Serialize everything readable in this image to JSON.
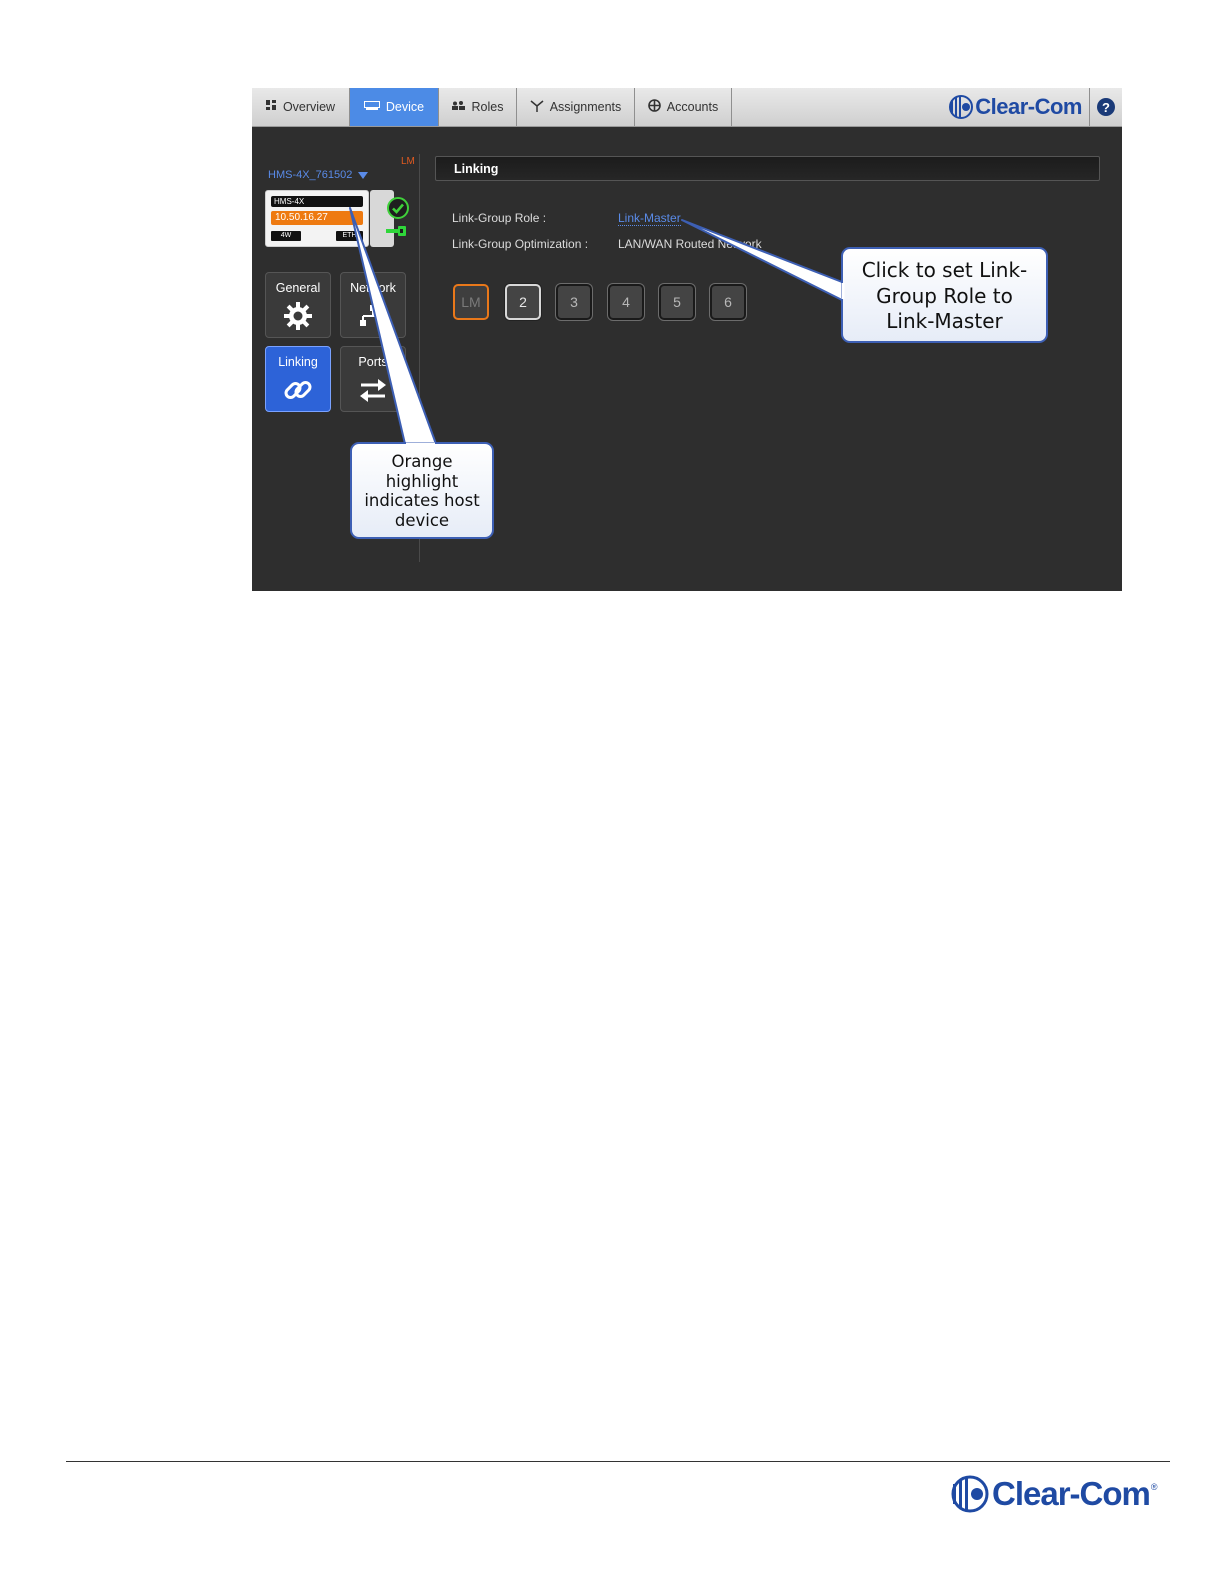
{
  "tabs": [
    {
      "label": "Overview",
      "icon": "grid-icon",
      "active": false
    },
    {
      "label": "Device",
      "icon": "device-icon",
      "active": true
    },
    {
      "label": "Roles",
      "icon": "roles-icon",
      "active": false
    },
    {
      "label": "Assignments",
      "icon": "assignments-icon",
      "active": false
    },
    {
      "label": "Accounts",
      "icon": "accounts-icon",
      "active": false
    }
  ],
  "brand": {
    "name": "Clear-Com",
    "color": "#1f4aa3"
  },
  "help": {
    "label": "?"
  },
  "sidebar": {
    "lm_flag": "LM",
    "device_select": "HMS-4X_761502",
    "device_card": {
      "name": "HMS-4X",
      "ip": "10.50.16.27",
      "port1": "4W",
      "port2": "ETH"
    },
    "nav": [
      {
        "label": "General",
        "icon": "gear-icon",
        "active": false
      },
      {
        "label": "Network",
        "icon": "network-icon",
        "active": false
      },
      {
        "label": "Linking",
        "icon": "link-icon",
        "active": true
      },
      {
        "label": "Ports",
        "icon": "arrows-icon",
        "active": false
      }
    ]
  },
  "linking": {
    "section_title": "Linking",
    "role_label": "Link-Group Role :",
    "role_value": "Link-Master",
    "optimization_label": "Link-Group Optimization :",
    "optimization_value": "LAN/WAN Routed Network",
    "slots": [
      "LM",
      "2",
      "3",
      "4",
      "5",
      "6"
    ]
  },
  "callouts": {
    "role": [
      "Click to set Link-",
      "Group Role to",
      "Link-Master"
    ],
    "host": [
      "Orange",
      "highlight",
      "indicates host",
      "device"
    ]
  },
  "colors": {
    "accent": "#4c8be6",
    "host_highlight": "#ee7a11",
    "active_nav": "#2d63d8",
    "link_text": "#5a8be8"
  }
}
